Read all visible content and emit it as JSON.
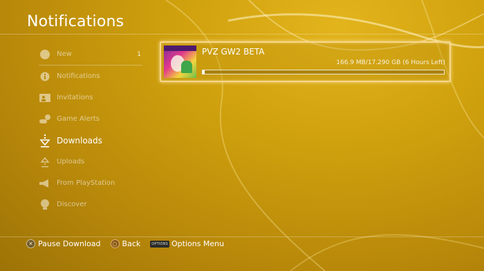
{
  "header": {
    "title": "Notifications"
  },
  "sidebar": {
    "items": [
      {
        "label": "New",
        "icon": "sun-icon",
        "count": "1"
      },
      {
        "label": "Notifications",
        "icon": "info-icon"
      },
      {
        "label": "Invitations",
        "icon": "invitation-icon"
      },
      {
        "label": "Game Alerts",
        "icon": "controller-alert-icon"
      },
      {
        "label": "Downloads",
        "icon": "download-arrow-icon",
        "active": true
      },
      {
        "label": "Uploads",
        "icon": "upload-arrow-icon"
      },
      {
        "label": "From PlayStation",
        "icon": "megaphone-icon"
      },
      {
        "label": "Discover",
        "icon": "lightbulb-icon"
      }
    ]
  },
  "download": {
    "title": "PVZ GW2 BETA",
    "status": "166.9 MB/17.290 GB (6 Hours Left)",
    "progress": 0.01
  },
  "footer": {
    "pause": {
      "glyph": "✕",
      "label": "Pause Download"
    },
    "back": {
      "glyph": "○",
      "label": "Back"
    },
    "options": {
      "badge": "OPTIONS",
      "label": "Options Menu"
    }
  },
  "colors": {
    "highlight": "#f8d68a",
    "background": "#cfa00d"
  }
}
